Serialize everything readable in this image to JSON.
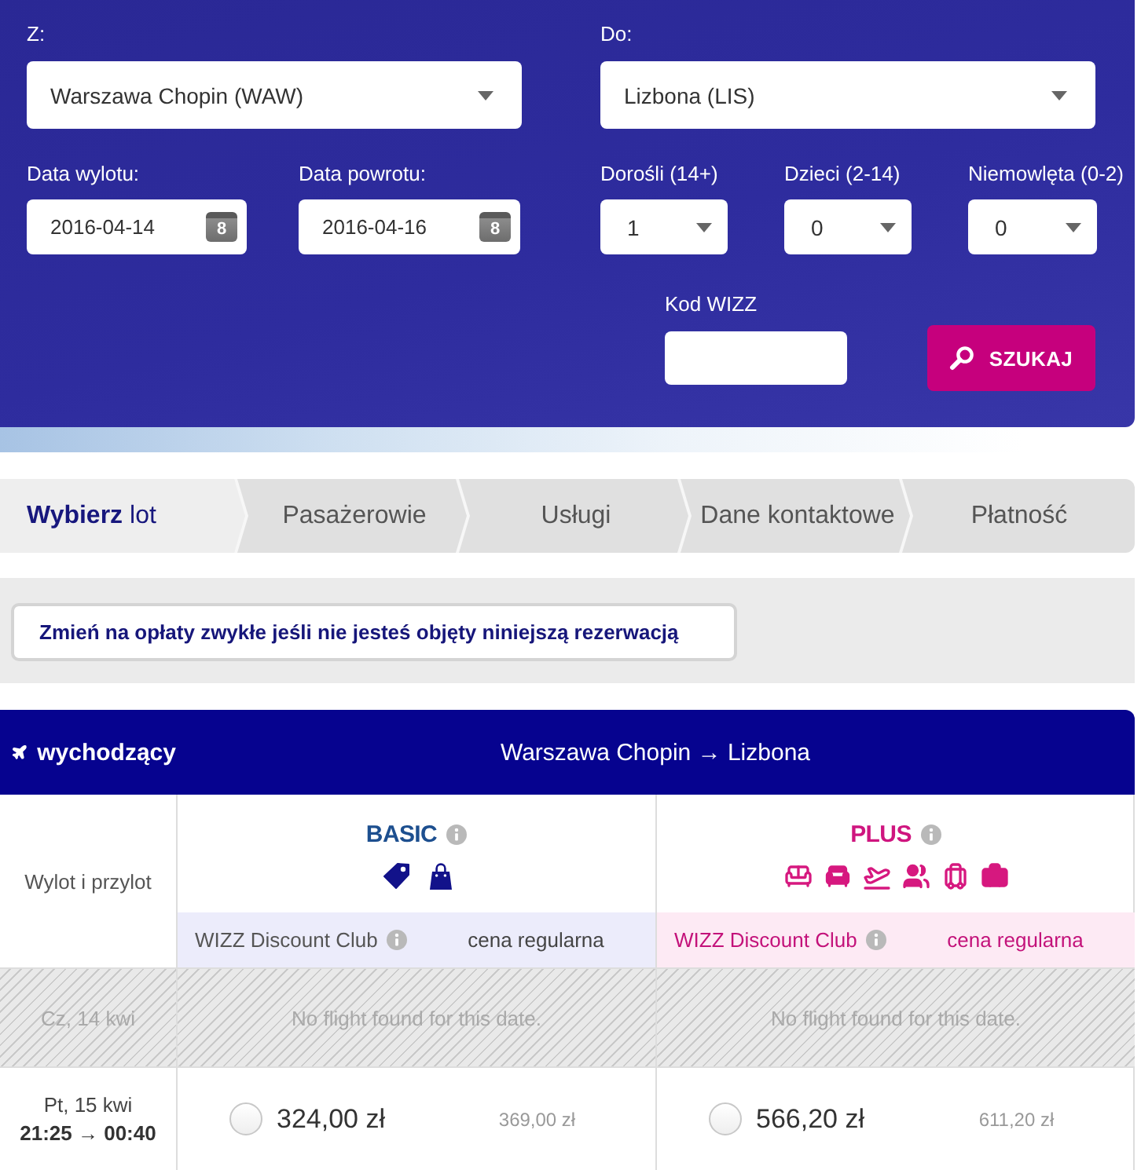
{
  "search": {
    "from": {
      "label": "Z:",
      "value": "Warszawa Chopin (WAW)"
    },
    "to": {
      "label": "Do:",
      "value": "Lizbona (LIS)"
    },
    "dates": [
      {
        "label": "Data wylotu:",
        "value": "2016-04-14",
        "calendar_day": "8"
      },
      {
        "label": "Data powrotu:",
        "value": "2016-04-16",
        "calendar_day": "8"
      }
    ],
    "passengers": [
      {
        "label": "Dorośli (14+)",
        "value": "1"
      },
      {
        "label": "Dzieci (2-14)",
        "value": "0"
      },
      {
        "label": "Niemowlęta (0-2)",
        "value": "0"
      }
    ],
    "promo_code": {
      "label": "Kod WIZZ"
    },
    "search_button": "SZUKAJ"
  },
  "steps": [
    {
      "label": "**Wybierz** lot",
      "selected": true
    },
    {
      "label": "Pasażerowie",
      "selected": false
    },
    {
      "label": "Usługi",
      "selected": false
    },
    {
      "label": "Dane kontaktowe",
      "selected": false
    },
    {
      "label": "Płatność",
      "selected": false
    }
  ],
  "fare_notice_button": "Zmień na opłaty zwykłe jeśli nie jesteś objęty niniejszą rezerwacją",
  "flights": {
    "direction": "wychodzący",
    "route": "Warszawa Chopin → Lizbona",
    "row_header": "Wylot i przylot",
    "fares": [
      {
        "name": "BASIC",
        "kind": "basic",
        "discount_label": "WIZZ Discount Club",
        "regular_label": "cena regularna"
      },
      {
        "name": "PLUS",
        "kind": "plus",
        "discount_label": "WIZZ Discount Club",
        "regular_label": "cena regularna"
      }
    ],
    "rows": [
      {
        "kind": "unavailable",
        "date": "Cz, 14 kwi",
        "messages": [
          "No flight found for this date.",
          "No flight found for this date."
        ]
      },
      {
        "kind": "available",
        "date": "Pt, 15 kwi",
        "times": "21:25 → 00:40",
        "prices": [
          {
            "discount": "324,00 zł",
            "regular": "369,00 zł",
            "selected": false
          },
          {
            "discount": "566,20 zł",
            "regular": "611,20 zł",
            "selected": false
          }
        ]
      }
    ]
  }
}
